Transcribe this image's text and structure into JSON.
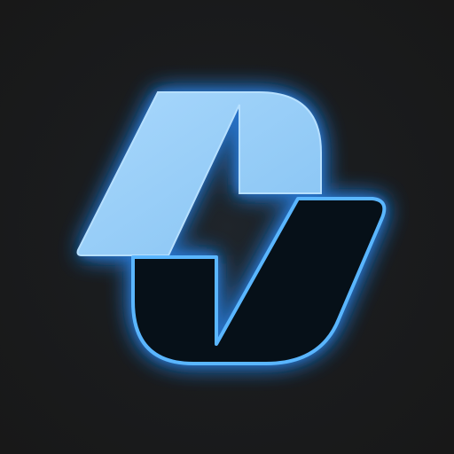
{
  "logo": {
    "icon": "lightning-bolt-logo-icon",
    "colors": {
      "background": "#181818",
      "glow": "#2f8fff",
      "upper_fill": "#8fcaf7",
      "upper_fill_light": "#a6d6fb",
      "outline": "#4fb0ff",
      "lower_fill": "#061018"
    }
  }
}
